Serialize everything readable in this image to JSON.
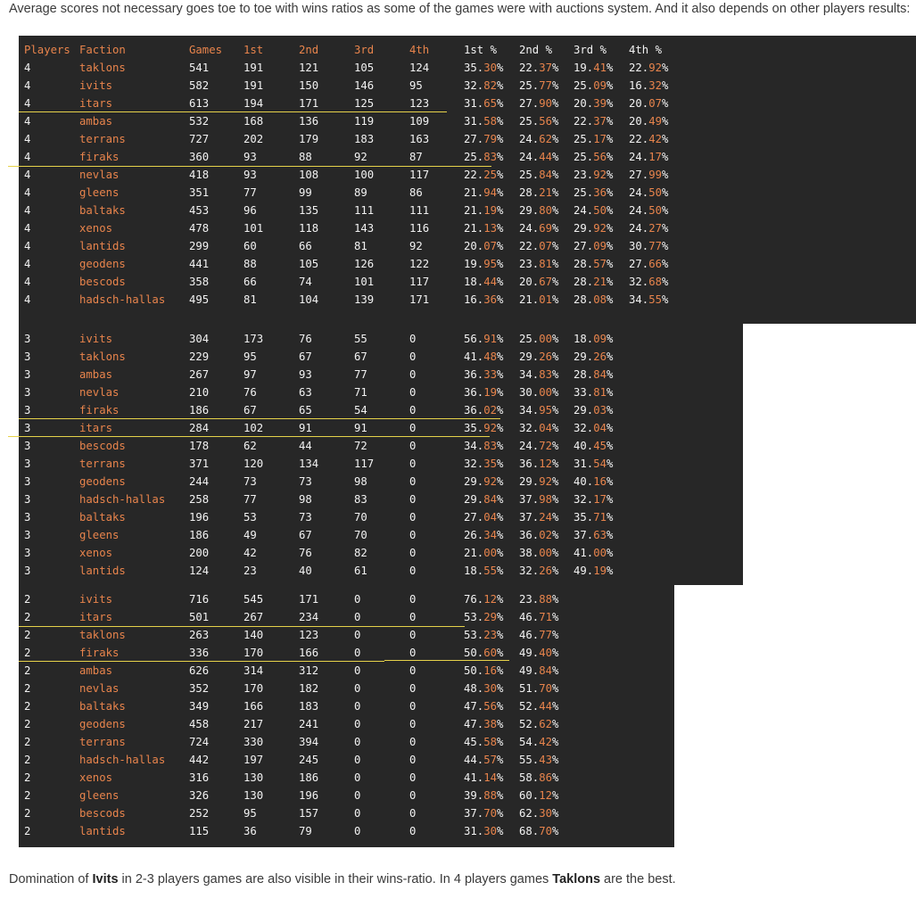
{
  "intro_text": "Average scores not necessary goes toe to toe with wins ratios as some of the games were with auctions system. And it also depends on other players results:",
  "outro": {
    "part1": "Domination of ",
    "ivits": "Ivits",
    "part2": " in 2-3 players games are also visible in their wins-ratio. In 4 players games ",
    "taklons": "Taklons",
    "part3": " are the best."
  },
  "headers": [
    "Players",
    "Faction",
    "Games",
    "1st",
    "2nd",
    "3rd",
    "4th",
    "1st %",
    "2nd %",
    "3rd %",
    "4th %"
  ],
  "colors": {
    "background": "#272727",
    "text": "#f2f2f2",
    "accent": "#e8844c",
    "highlight": "#e6d24a"
  },
  "tables": [
    {
      "players": "4",
      "rows": [
        [
          "4",
          "taklons",
          "541",
          "191",
          "121",
          "105",
          "124",
          "35.30%",
          "22.37%",
          "19.41%",
          "22.92%"
        ],
        [
          "4",
          "ivits",
          "582",
          "191",
          "150",
          "146",
          "95",
          "32.82%",
          "25.77%",
          "25.09%",
          "16.32%"
        ],
        [
          "4",
          "itars",
          "613",
          "194",
          "171",
          "125",
          "123",
          "31.65%",
          "27.90%",
          "20.39%",
          "20.07%"
        ],
        [
          "4",
          "ambas",
          "532",
          "168",
          "136",
          "119",
          "109",
          "31.58%",
          "25.56%",
          "22.37%",
          "20.49%"
        ],
        [
          "4",
          "terrans",
          "727",
          "202",
          "179",
          "183",
          "163",
          "27.79%",
          "24.62%",
          "25.17%",
          "22.42%"
        ],
        [
          "4",
          "firaks",
          "360",
          "93",
          "88",
          "92",
          "87",
          "25.83%",
          "24.44%",
          "25.56%",
          "24.17%"
        ],
        [
          "4",
          "nevlas",
          "418",
          "93",
          "108",
          "100",
          "117",
          "22.25%",
          "25.84%",
          "23.92%",
          "27.99%"
        ],
        [
          "4",
          "gleens",
          "351",
          "77",
          "99",
          "89",
          "86",
          "21.94%",
          "28.21%",
          "25.36%",
          "24.50%"
        ],
        [
          "4",
          "baltaks",
          "453",
          "96",
          "135",
          "111",
          "111",
          "21.19%",
          "29.80%",
          "24.50%",
          "24.50%"
        ],
        [
          "4",
          "xenos",
          "478",
          "101",
          "118",
          "143",
          "116",
          "21.13%",
          "24.69%",
          "29.92%",
          "24.27%"
        ],
        [
          "4",
          "lantids",
          "299",
          "60",
          "66",
          "81",
          "92",
          "20.07%",
          "22.07%",
          "27.09%",
          "30.77%"
        ],
        [
          "4",
          "geodens",
          "441",
          "88",
          "105",
          "126",
          "122",
          "19.95%",
          "23.81%",
          "28.57%",
          "27.66%"
        ],
        [
          "4",
          "bescods",
          "358",
          "66",
          "74",
          "101",
          "117",
          "18.44%",
          "20.67%",
          "28.21%",
          "32.68%"
        ],
        [
          "4",
          "hadsch-hallas",
          "495",
          "81",
          "104",
          "139",
          "171",
          "16.36%",
          "21.01%",
          "28.08%",
          "34.55%"
        ]
      ]
    },
    {
      "players": "3",
      "rows": [
        [
          "3",
          "ivits",
          "304",
          "173",
          "76",
          "55",
          "0",
          "56.91%",
          "25.00%",
          "18.09%"
        ],
        [
          "3",
          "taklons",
          "229",
          "95",
          "67",
          "67",
          "0",
          "41.48%",
          "29.26%",
          "29.26%"
        ],
        [
          "3",
          "ambas",
          "267",
          "97",
          "93",
          "77",
          "0",
          "36.33%",
          "34.83%",
          "28.84%"
        ],
        [
          "3",
          "nevlas",
          "210",
          "76",
          "63",
          "71",
          "0",
          "36.19%",
          "30.00%",
          "33.81%"
        ],
        [
          "3",
          "firaks",
          "186",
          "67",
          "65",
          "54",
          "0",
          "36.02%",
          "34.95%",
          "29.03%"
        ],
        [
          "3",
          "itars",
          "284",
          "102",
          "91",
          "91",
          "0",
          "35.92%",
          "32.04%",
          "32.04%"
        ],
        [
          "3",
          "bescods",
          "178",
          "62",
          "44",
          "72",
          "0",
          "34.83%",
          "24.72%",
          "40.45%"
        ],
        [
          "3",
          "terrans",
          "371",
          "120",
          "134",
          "117",
          "0",
          "32.35%",
          "36.12%",
          "31.54%"
        ],
        [
          "3",
          "geodens",
          "244",
          "73",
          "73",
          "98",
          "0",
          "29.92%",
          "29.92%",
          "40.16%"
        ],
        [
          "3",
          "hadsch-hallas",
          "258",
          "77",
          "98",
          "83",
          "0",
          "29.84%",
          "37.98%",
          "32.17%"
        ],
        [
          "3",
          "baltaks",
          "196",
          "53",
          "73",
          "70",
          "0",
          "27.04%",
          "37.24%",
          "35.71%"
        ],
        [
          "3",
          "gleens",
          "186",
          "49",
          "67",
          "70",
          "0",
          "26.34%",
          "36.02%",
          "37.63%"
        ],
        [
          "3",
          "xenos",
          "200",
          "42",
          "76",
          "82",
          "0",
          "21.00%",
          "38.00%",
          "41.00%"
        ],
        [
          "3",
          "lantids",
          "124",
          "23",
          "40",
          "61",
          "0",
          "18.55%",
          "32.26%",
          "49.19%"
        ]
      ]
    },
    {
      "players": "2",
      "rows": [
        [
          "2",
          "ivits",
          "716",
          "545",
          "171",
          "0",
          "0",
          "76.12%",
          "23.88%"
        ],
        [
          "2",
          "itars",
          "501",
          "267",
          "234",
          "0",
          "0",
          "53.29%",
          "46.71%"
        ],
        [
          "2",
          "taklons",
          "263",
          "140",
          "123",
          "0",
          "0",
          "53.23%",
          "46.77%"
        ],
        [
          "2",
          "firaks",
          "336",
          "170",
          "166",
          "0",
          "0",
          "50.60%",
          "49.40%"
        ],
        [
          "2",
          "ambas",
          "626",
          "314",
          "312",
          "0",
          "0",
          "50.16%",
          "49.84%"
        ],
        [
          "2",
          "nevlas",
          "352",
          "170",
          "182",
          "0",
          "0",
          "48.30%",
          "51.70%"
        ],
        [
          "2",
          "baltaks",
          "349",
          "166",
          "183",
          "0",
          "0",
          "47.56%",
          "52.44%"
        ],
        [
          "2",
          "geodens",
          "458",
          "217",
          "241",
          "0",
          "0",
          "47.38%",
          "52.62%"
        ],
        [
          "2",
          "terrans",
          "724",
          "330",
          "394",
          "0",
          "0",
          "45.58%",
          "54.42%"
        ],
        [
          "2",
          "hadsch-hallas",
          "442",
          "197",
          "245",
          "0",
          "0",
          "44.57%",
          "55.43%"
        ],
        [
          "2",
          "xenos",
          "316",
          "130",
          "186",
          "0",
          "0",
          "41.14%",
          "58.86%"
        ],
        [
          "2",
          "gleens",
          "326",
          "130",
          "196",
          "0",
          "0",
          "39.88%",
          "60.12%"
        ],
        [
          "2",
          "bescods",
          "252",
          "95",
          "157",
          "0",
          "0",
          "37.70%",
          "62.30%"
        ],
        [
          "2",
          "lantids",
          "115",
          "36",
          "79",
          "0",
          "0",
          "31.30%",
          "68.70%"
        ]
      ]
    }
  ]
}
